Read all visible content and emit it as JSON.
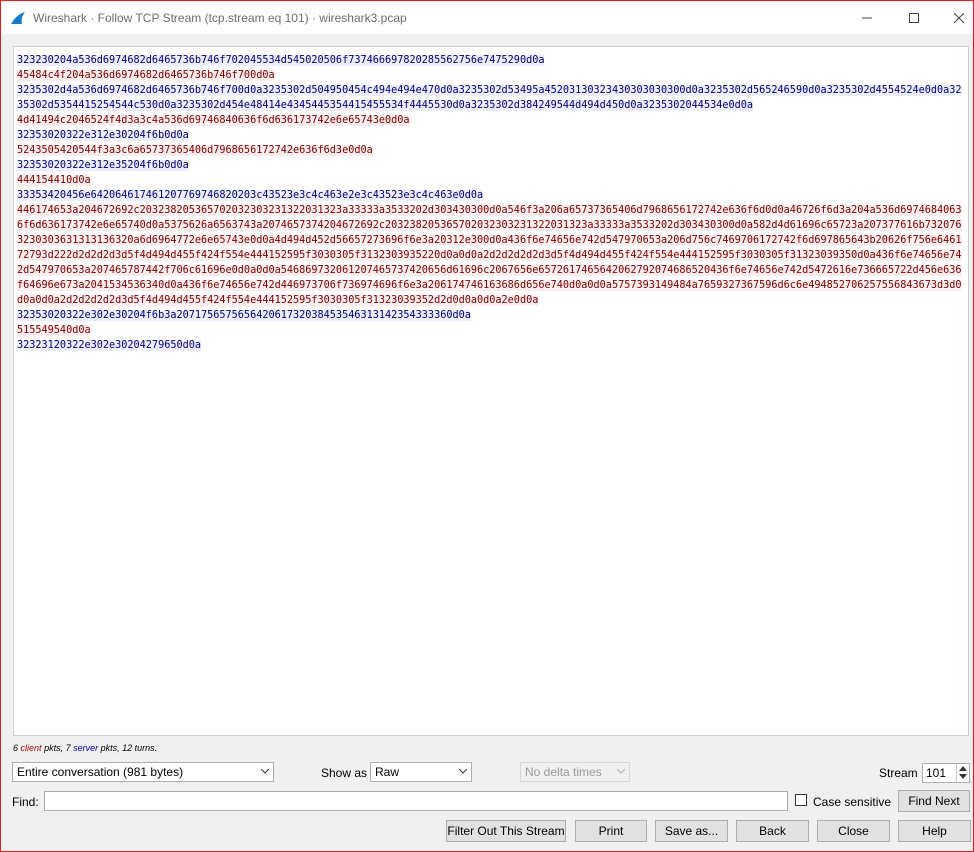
{
  "window": {
    "title": "Wireshark · Follow TCP Stream (tcp.stream eq 101) · wireshark3.pcap"
  },
  "stream_chunks": [
    {
      "dir": "server",
      "text": "323230204a536d6974682d6465736b746f702045534d545020506f737466697820285562756e7475290d0a"
    },
    {
      "dir": "client",
      "text": "45484c4f204a536d6974682d6465736b746f700d0a"
    },
    {
      "dir": "server",
      "text": "3235302d4a536d6974682d6465736b746f700d0a3235302d504950454c494e494e470d0a3235302d53495a45203130323430303030300d0a3235302d565246590d0a3235302d4554524e0d0a3235302d5354415254544c530d0a3235302d454e48414e4345445354415455534f4445530d0a3235302d384249544d494d450d0a3235302044534e0d0a"
    },
    {
      "dir": "client",
      "text": "4d41494c2046524f4d3a3c4a536d69746840636f6d636173742e6e65743e0d0a"
    },
    {
      "dir": "server",
      "text": "32353020322e312e30204f6b0d0a"
    },
    {
      "dir": "client",
      "text": "5243505420544f3a3c6a65737365406d7968656172742e636f6d3e0d0a"
    },
    {
      "dir": "server",
      "text": "32353020322e312e35204f6b0d0a"
    },
    {
      "dir": "client",
      "text": "444154410d0a"
    },
    {
      "dir": "server",
      "text": "33353420456e642064617461207769746820203c43523e3c4c463e2e3c43523e3c4c463e0d0a"
    },
    {
      "dir": "client",
      "text": "446174653a204672692c203238205365702032303231322031323a33333a3533202d303430300d0a546f3a206a65737365406d7968656172742e636f6d0d0a46726f6d3a204a536d69746840636f6d636173742e6e65740d0a5375626a6563743a2074657374204672692c203238205365702032303231322031323a33333a3533202d303430300d0a582d4d61696c65723a207377616b7320763230303631313136320a6d6964772e6e65743e0d0a4d494d452d56657273696f6e3a20312e300d0a436f6e74656e742d547970653a206d756c7469706172742f6d697865643b20626f756e646172793d222d2d2d2d3d5f4d494d455f424f554e444152595f3030305f3132303935220d0a0d0a2d2d2d2d2d3d5f4d494d455f424f554e444152595f3030305f31323039350d0a436f6e74656e742d547970653a207465787442f706c61696e0d0a0d0a546869732061207465737420656d61696c2067656e6572617465642062792074686520436f6e74656e742d5472616e736665722d456e636f64696e673a2041534536340d0a436f6e74656e742d446973706f736974696f6e3a206174746163686d656e740d0a0d0a5757393149484a7659327367596d6c6e494852706257556843673d3d0d0a0d0a2d2d2d2d2d3d5f4d494d455f424f554e444152595f3030305f31323039352d2d0d0a0d0a2e0d0a"
    },
    {
      "dir": "server",
      "text": "32353020322e302e30204f6b3a207175657565642061732038453546313142354333360d0a"
    },
    {
      "dir": "client",
      "text": "515549540d0a"
    },
    {
      "dir": "server",
      "text": "32323120322e302e30204279650d0a"
    }
  ],
  "stats": {
    "client_count": "6",
    "client_word": "client",
    "pkts_sep": " pkts, ",
    "server_count": "7",
    "server_word": "server",
    "tail": " pkts, 12 turns."
  },
  "controls": {
    "conversation_select": "Entire conversation (981 bytes)",
    "show_as_label": "Show as",
    "show_as_value": "Raw",
    "delta_times_value": "No delta times",
    "stream_label": "Stream",
    "stream_value": "101",
    "find_label": "Find:",
    "find_value": "",
    "case_sensitive_label": "Case sensitive",
    "find_next_label": "Find Next"
  },
  "buttons": {
    "filter_out": "Filter Out This Stream",
    "print": "Print",
    "save_as": "Save as...",
    "back": "Back",
    "close": "Close",
    "help": "Help"
  }
}
